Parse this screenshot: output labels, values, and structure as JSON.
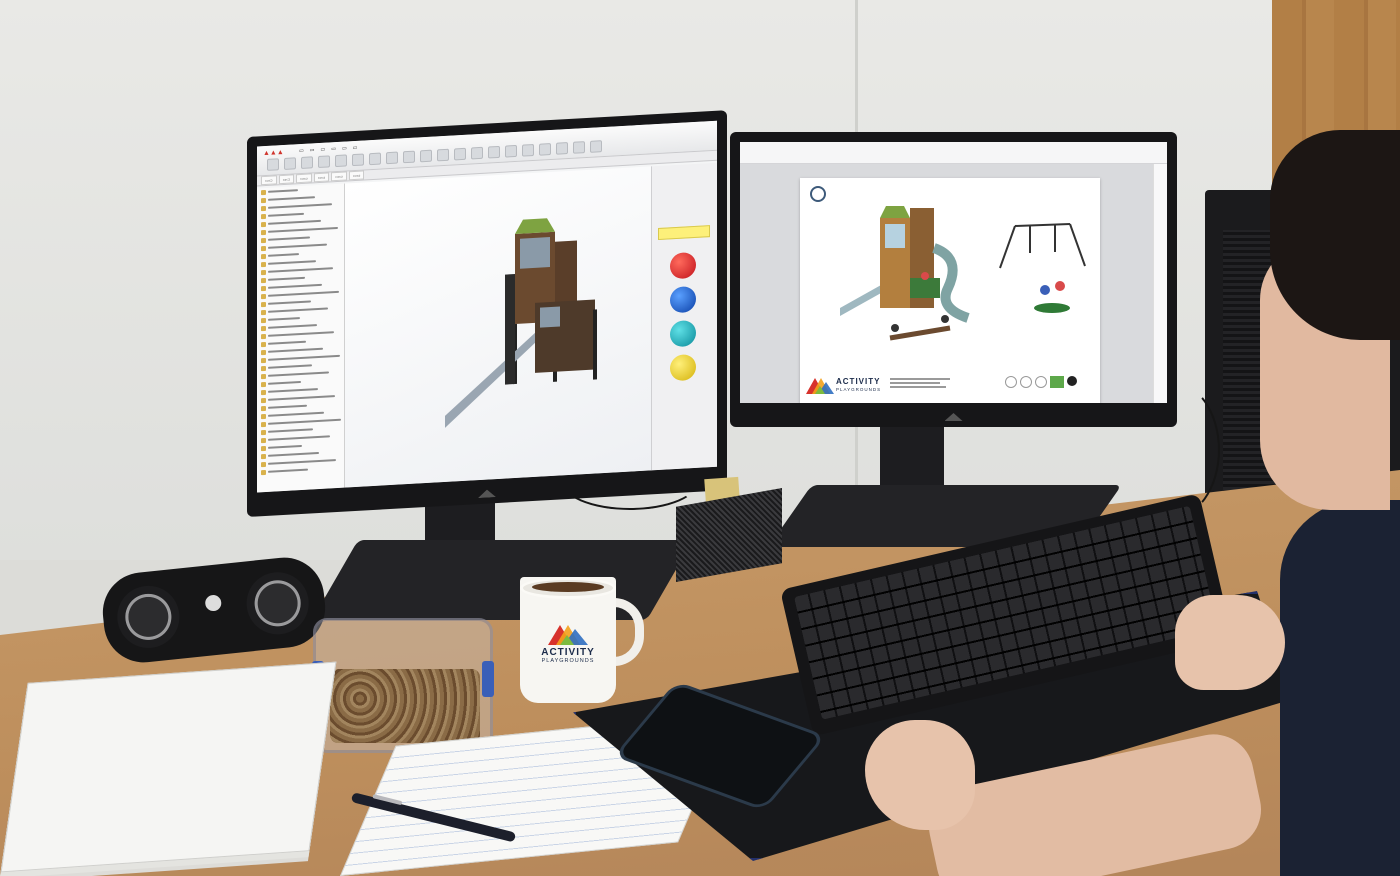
{
  "scene": {
    "description_colors": {
      "brand_red": "#d7322c",
      "brand_orange": "#f3a11b",
      "brand_green": "#7dbb3e",
      "brand_blue": "#2f6fc1",
      "brand_navy": "#1b2b4a"
    }
  },
  "pdf_page": {
    "brand_word": "ACTIVITY",
    "brand_sub": "PLAYGROUNDS"
  },
  "mug": {
    "brand_word": "ACTIVITY",
    "brand_sub": "PLAYGROUNDS"
  }
}
